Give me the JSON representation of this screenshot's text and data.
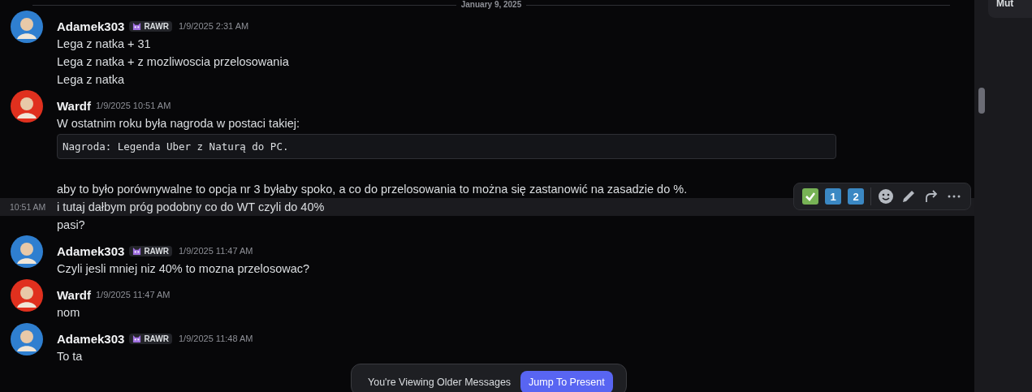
{
  "divider": {
    "label": "January 9, 2025"
  },
  "side_panel": {
    "card_text": "Mut"
  },
  "messages": [
    {
      "author": "Adamek303",
      "color": "#2f7fd0",
      "badge": "RAWR",
      "time": "1/9/2025 2:31 AM",
      "lines": [
        {
          "kind": "text",
          "text": "Lega z natka + 31"
        },
        {
          "kind": "text",
          "text": "Lega z natka + z mozliwoscia przelosowania"
        },
        {
          "kind": "text",
          "text": "Lega z natka"
        }
      ]
    },
    {
      "author": "Wardf",
      "color": "#e0301e",
      "time": "1/9/2025 10:51 AM",
      "lines": [
        {
          "kind": "text",
          "text": "W ostatnim roku była nagroda w postaci takiej:"
        },
        {
          "kind": "code",
          "text": "Nagroda: Legenda Uber z Naturą do PC."
        },
        {
          "kind": "spacer"
        },
        {
          "kind": "text",
          "text": "aby to było porównywalne to opcja nr 3 byłaby spoko, a co do przelosowania to można się zastanowić na zasadzie do %."
        },
        {
          "kind": "text",
          "text": "i tutaj dałbym próg podobny co do WT czyli do 40%",
          "highlighted": true,
          "hover_time": "10:51 AM"
        },
        {
          "kind": "text",
          "text": "pasi?"
        }
      ]
    },
    {
      "author": "Adamek303",
      "color": "#2f7fd0",
      "badge": "RAWR",
      "time": "1/9/2025 11:47 AM",
      "lines": [
        {
          "kind": "text",
          "text": "Czyli jesli mniej niz 40% to mozna przelosowac?"
        }
      ]
    },
    {
      "author": "Wardf",
      "color": "#e0301e",
      "time": "1/9/2025 11:47 AM",
      "lines": [
        {
          "kind": "text",
          "text": "nom"
        }
      ]
    },
    {
      "author": "Adamek303",
      "color": "#2f7fd0",
      "badge": "RAWR",
      "time": "1/9/2025 11:48 AM",
      "lines": [
        {
          "kind": "text",
          "text": "To ta"
        }
      ]
    }
  ],
  "hover_toolbar": {
    "reactions": [
      {
        "kind": "check"
      },
      {
        "kind": "key",
        "text": "1"
      },
      {
        "kind": "key",
        "text": "2"
      }
    ]
  },
  "older_bar": {
    "text": "You're Viewing Older Messages",
    "button": "Jump To Present"
  }
}
